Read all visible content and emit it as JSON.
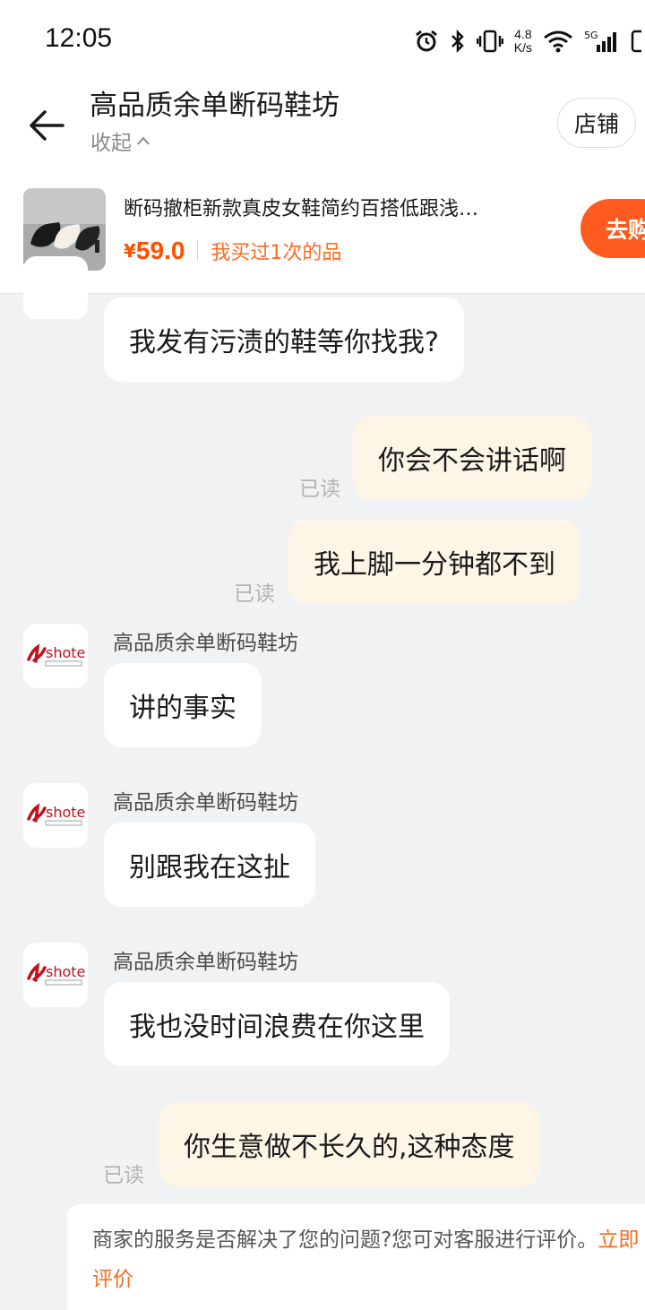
{
  "status_bar": {
    "time": "12:05",
    "net_speed_value": "4.8",
    "net_speed_unit": "K/s",
    "network": "5G"
  },
  "header": {
    "title": "高品质余单断码鞋坊",
    "collapse": "收起",
    "store_button": "店铺"
  },
  "product": {
    "title": "断码撤柜新款真皮女鞋简约百搭低跟浅…",
    "price_symbol": "¥",
    "price": "59.0",
    "purchase_note": "我买过1次的品",
    "buy_button": "去购"
  },
  "messages": [
    {
      "side": "in",
      "text": "我发有污渍的鞋等你找我?"
    },
    {
      "side": "out",
      "text": "你会不会讲话啊",
      "status": "已读"
    },
    {
      "side": "out",
      "text": "我上脚一分钟都不到",
      "status": "已读"
    },
    {
      "side": "in",
      "sender": "高品质余单断码鞋坊",
      "avatar_text": "shote",
      "text": "讲的事实"
    },
    {
      "side": "in",
      "sender": "高品质余单断码鞋坊",
      "avatar_text": "shote",
      "text": "别跟我在这扯"
    },
    {
      "side": "in",
      "sender": "高品质余单断码鞋坊",
      "avatar_text": "shote",
      "text": "我也没时间浪费在你这里"
    },
    {
      "side": "out",
      "text": "你生意做不长久的,这种态度",
      "status": "已读"
    }
  ],
  "feedback": {
    "text": "商家的服务是否解决了您的问题?您可对客服进行评价。",
    "link": "立即评价"
  },
  "colors": {
    "accent": "#ff5000",
    "outgoing_bubble": "#fdf5e6",
    "background": "#f1f2f4"
  }
}
